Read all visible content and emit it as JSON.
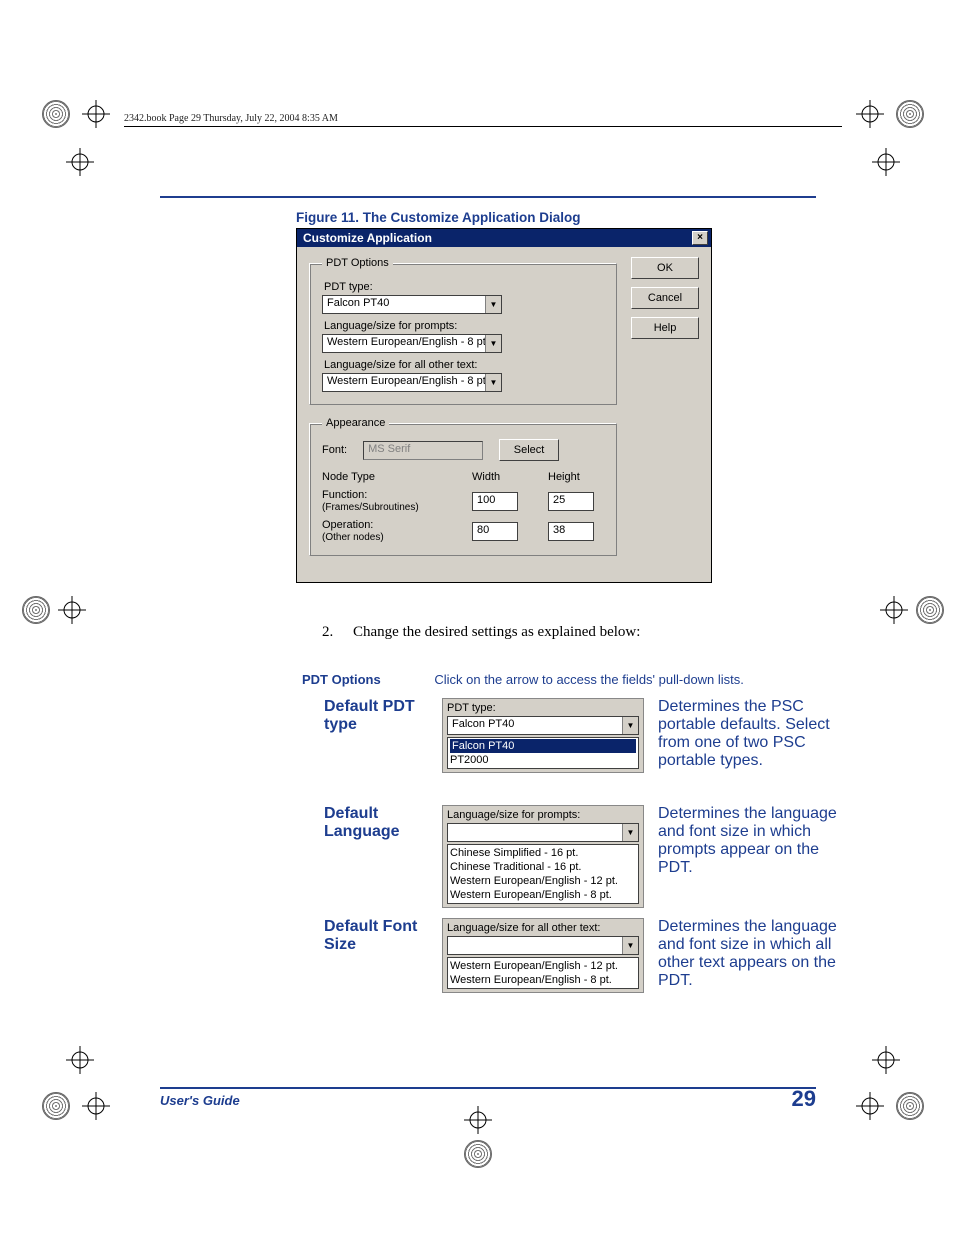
{
  "print": {
    "header": "2342.book  Page 29  Thursday, July 22, 2004  8:35 AM"
  },
  "figure": {
    "caption": "Figure 11. The Customize Application Dialog"
  },
  "dialog": {
    "title": "Customize Application",
    "close_glyph": "×",
    "buttons": {
      "ok": "OK",
      "cancel": "Cancel",
      "help": "Help"
    },
    "pdt": {
      "legend": "PDT Options",
      "type_label": "PDT type:",
      "type_value": "Falcon PT40",
      "prompt_label": "Language/size for prompts:",
      "prompt_value": "Western European/English - 8 pt.",
      "other_label": "Language/size for all other text:",
      "other_value": "Western European/English - 8 pt."
    },
    "appearance": {
      "legend": "Appearance",
      "font_label": "Font:",
      "font_value": "MS Serif",
      "select_btn": "Select",
      "headers": {
        "node": "Node Type",
        "width": "Width",
        "height": "Height"
      },
      "function_label": "Function:",
      "function_sub": "(Frames/Subroutines)",
      "function_w": "100",
      "function_h": "25",
      "operation_label": "Operation:",
      "operation_sub": "(Other nodes)",
      "operation_w": "80",
      "operation_h": "38"
    }
  },
  "step": {
    "num": "2.",
    "text": "Change the desired settings as explained below:"
  },
  "doc": {
    "pdt_options_label": "PDT Options",
    "pdt_options_text": "Click on the arrow to access the fields' pull-down lists.",
    "a": {
      "label": "Default PDT type",
      "snippet_label": "PDT type:",
      "snippet_value": "Falcon PT40",
      "opt_sel": "Falcon PT40",
      "opt_2": "PT2000",
      "desc": "Determines the PSC portable defaults. Select from one of two PSC portable types."
    },
    "b": {
      "label": "Default Language",
      "snippet_label": "Language/size for prompts:",
      "opt1": "Chinese Simplified - 16 pt.",
      "opt2": "Chinese Traditional - 16 pt.",
      "opt3": "Western European/English - 12 pt.",
      "opt4": "Western European/English - 8 pt.",
      "desc": "Determines the language and font size in which prompts appear on the PDT."
    },
    "c": {
      "label": "Default Font Size",
      "snippet_label": "Language/size for all other text:",
      "opt1": "Western European/English - 12 pt.",
      "opt2": "Western European/English - 8 pt.",
      "desc": "Determines the language and font size in which all other text appears on the PDT."
    }
  },
  "footer": {
    "left": "User's Guide",
    "page": "29"
  },
  "glyph": {
    "arrow_down": "▼"
  }
}
